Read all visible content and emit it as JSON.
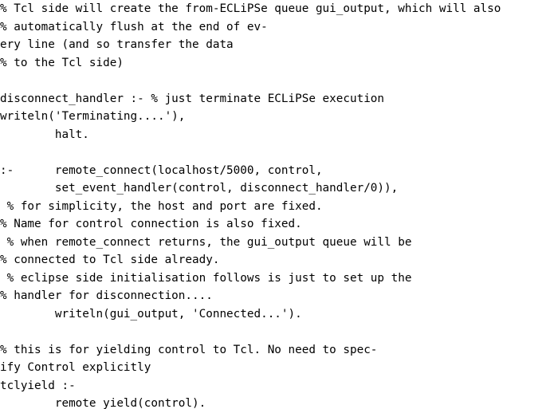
{
  "document": {
    "lines": [
      "% Tcl side will create the from-ECLiPSe queue gui_output, which will also",
      "% automatically flush at the end of ev-",
      "ery line (and so transfer the data",
      "% to the Tcl side)",
      "",
      "disconnect_handler :- % just terminate ECLiPSe execution",
      "writeln('Terminating....'),",
      "        halt.",
      "",
      ":-      remote_connect(localhost/5000, control,",
      "        set_event_handler(control, disconnect_handler/0)),",
      " % for simplicity, the host and port are fixed.",
      "% Name for control connection is also fixed.",
      " % when remote_connect returns, the gui_output queue will be",
      "% connected to Tcl side already.",
      " % eclipse side initialisation follows is just to set up the",
      "% handler for disconnection....",
      "        writeln(gui_output, 'Connected...').",
      "",
      "% this is for yielding control to Tcl. No need to spec-",
      "ify Control explicitly",
      "tclyield :-",
      "        remote_yield(control)."
    ]
  }
}
